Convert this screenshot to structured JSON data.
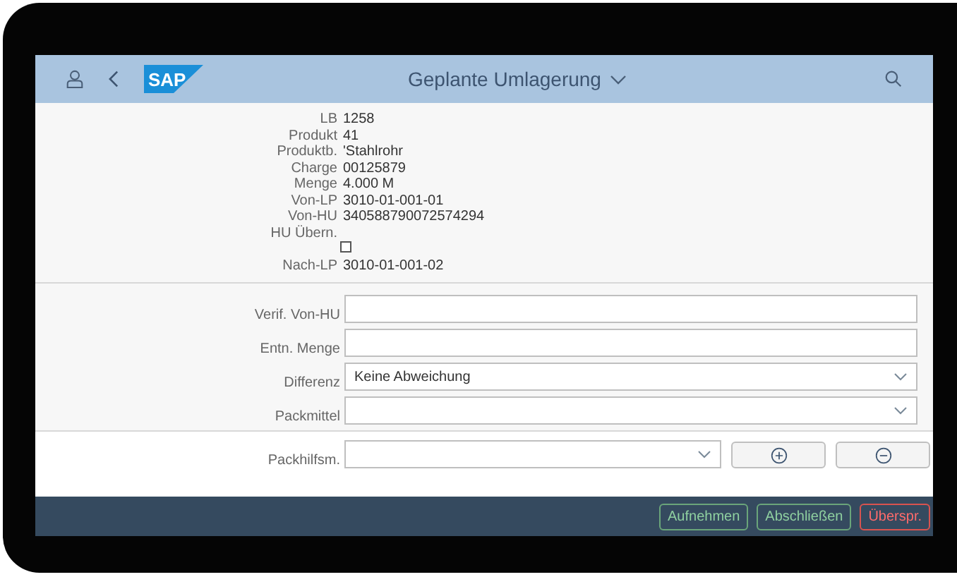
{
  "header": {
    "logo": "SAP",
    "title": "Geplante Umlagerung"
  },
  "details": [
    {
      "kind": "text",
      "label": "LB",
      "value": "1258"
    },
    {
      "kind": "text",
      "label": "Produkt",
      "value": "41"
    },
    {
      "kind": "text",
      "label": "Produktb.",
      "value": "'Stahlrohr"
    },
    {
      "kind": "text",
      "label": "Charge",
      "value": "00125879"
    },
    {
      "kind": "text",
      "label": "Menge",
      "value": "4.000 M"
    },
    {
      "kind": "text",
      "label": "Von-LP",
      "value": "3010-01-001-01"
    },
    {
      "kind": "text",
      "label": "Von-HU",
      "value": "340588790072574294"
    },
    {
      "kind": "checkbox",
      "label": "HU Übern.",
      "checked": false
    },
    {
      "kind": "text",
      "label": "Nach-LP",
      "value": "3010-01-001-02"
    }
  ],
  "form": [
    {
      "kind": "input",
      "label": "Verif. Von-HU"
    },
    {
      "kind": "input",
      "label": "Entn. Menge"
    },
    {
      "kind": "select",
      "label": "Differenz",
      "value": "Keine Abweichung"
    },
    {
      "kind": "select",
      "label": "Packmittel"
    }
  ],
  "packing": {
    "label": "Packhilfsm."
  },
  "footer_buttons": [
    {
      "label": "Aufnehmen",
      "kind": "positive"
    },
    {
      "label": "Abschließen",
      "kind": "positive"
    },
    {
      "label": "Überspr.",
      "kind": "negative"
    }
  ]
}
